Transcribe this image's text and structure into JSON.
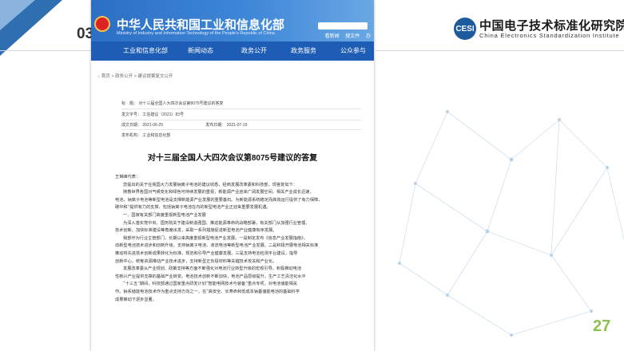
{
  "slide": {
    "section_number": "03",
    "page_number": "27",
    "org_logo_text": "CESI",
    "org_name_cn": "中国电子技术标准化研究院",
    "org_name_en": "China Electronics Standardization Institute",
    "accent_color": "#2f6fb1",
    "page_number_color": "#8cc152"
  },
  "site": {
    "title": "中华人民共和国工业和信息化部",
    "subtitle": "Ministry of Industry and Information Technology of the People's Republic of China",
    "top_links": [
      "看新闻",
      "搜文件",
      "办"
    ],
    "nav": [
      "工业和信息化部",
      "新闻动态",
      "政务公开",
      "政务服务",
      "公众参与"
    ],
    "breadcrumb": [
      "首页",
      "政务公开",
      "建议提案复文公开"
    ]
  },
  "meta": {
    "title_label": "标　题：",
    "title_value": "对十三届全国人大四次会议第8075号建议的答复",
    "doc_no_label": "发文字号：",
    "doc_no_value": "工信建议〔2021〕83号",
    "made_date_label": "成文日期：",
    "made_date_value": "2021-06-25",
    "pub_date_label": "发布日期：",
    "pub_date_value": "2021-07-19",
    "issuer_label": "发布机构：",
    "issuer_value": "工业和信息化部"
  },
  "document": {
    "heading": "对十三届全国人大四次会议第8075号建议的答复",
    "paragraphs": [
      "王琳峰代表：",
      "您提出的关于在我国大力发展钠离子电池的建议收悉，经商发展改革委和科技部，现答复如下：",
      "随着世界各国对气候变化和绿色可持续发展的重视，新能源产业迎来广阔发展空间，相关产业成长迅速，",
      "电池，钠离子电池等新型电池是支撑新能源产业发展的重要基石。为新能源系统稳定而高效运行提供了有力保障，",
      "碳中和”提供有力的支撑，包括钠离子电池在内的新型电池产业正迎来重要发展机遇。",
      "一、国家有关部门高度重视新型电池产业发展",
      "为深入落实党中央、国务院关于建设制造强国、推进能源革命的战略部署，有关部门从加强行业管理、",
      "技术创新、加快标准建设等角度出发，采取一系列措施促进新型电池产业健康有序发展。",
      "我部作为行业主管部门，长期以来高度重视新型电池产业发展。一是制定发布《信息产业发展指南》，",
      "动新型电池技术进步和创新升级，支持钠离子电池、液流电池等新型电池产业发展。二是积极开展电池相关标准",
      "推动将先进技术创新成果转化为标准，规范和引导产业健康发展。三是支持电池检测平台建设，指导",
      "创新中心，统筹资源推动产业技术进步，支持新型正负极材料等关键技术攻关和产业化。",
      "发展改革委从产业规划、政策支持等方面不断强化对电池行业转型升级的宏观引导，积极推动电池",
      "性新兴产业提供支撑的基础产业转变。电池技术创新不断加快，电池产品层级提升，生产工艺清洁化水平",
      "“十三五”期间，科技部通过国家重点研发计划“智能电网技术与装备”重点专项，对电池储能相关",
      "作。钠系储能电池技术作为重点支持方向之一，在“高安全、长寿命和低成本钠基储能电池的基础科学",
      "成果推动下逐步显著。"
    ]
  }
}
